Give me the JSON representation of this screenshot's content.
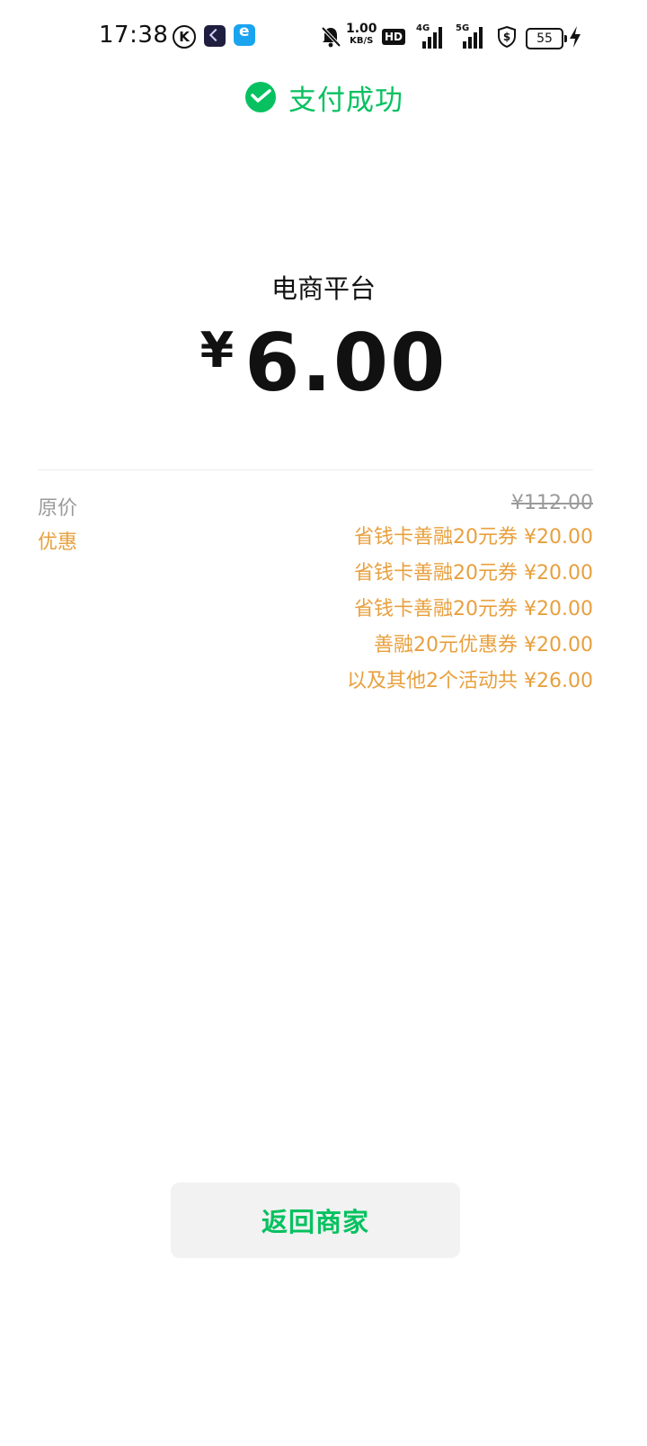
{
  "status_bar": {
    "time": "17:38",
    "net_speed_value": "1.00",
    "net_speed_unit": "KB/S",
    "hd_label": "HD",
    "sig1_label": "4G",
    "sig2_label": "5G",
    "battery": "55",
    "icons": [
      "k-app-icon",
      "dark-app-icon",
      "blue-app-icon",
      "mute-bell-icon",
      "shield-dollar-icon",
      "charging-bolt-icon"
    ]
  },
  "header": {
    "title": "支付成功",
    "icon": "wechat-pay-check-icon",
    "accent_color": "#07c160"
  },
  "payment": {
    "merchant": "电商平台",
    "currency": "¥",
    "amount": "6.00"
  },
  "details": {
    "original_label": "原价",
    "original_price": "¥112.00",
    "discount_label": "优惠",
    "discount_color": "#e8a03e",
    "discounts": [
      "省钱卡善融20元券 ¥20.00",
      "省钱卡善融20元券 ¥20.00",
      "省钱卡善融20元券 ¥20.00",
      "善融20元优惠券 ¥20.00",
      "以及其他2个活动共 ¥26.00"
    ]
  },
  "actions": {
    "back_label": "返回商家"
  }
}
